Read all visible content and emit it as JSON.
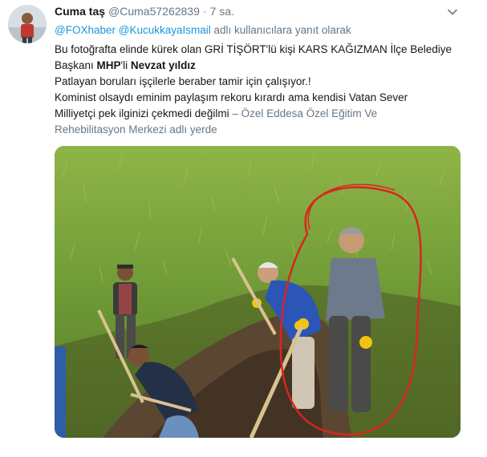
{
  "tweet": {
    "display_name": "Cuma taş",
    "handle": "@Cuma57262839",
    "separator": "·",
    "time": "7 sa.",
    "reply": {
      "mention_1": "@FOXhaber",
      "mention_2": "@KucukkayaIsmail",
      "suffix": "adlı kullanıcılara yanıt olarak"
    },
    "text": {
      "line1": "Bu fotoğrafta elinde kürek olan GRİ TİŞÖRT'lü kişi KARS KAĞIZMAN İlçe Belediye",
      "line2_pre": "Başkanı ",
      "line2_bold1": "MHP",
      "line2_mid": "'li ",
      "line2_bold2": "Nevzat yıldız",
      "line3": "Patlayan boruları işçilerle beraber tamir için çalışıyor.!",
      "line4": "Kominist olsaydı eminim paylaşım rekoru kırardı ama kendisi Vatan Sever",
      "line5_text": "Milliyetçi pek ilginizi çekmedi değilmi ",
      "line5_loc": " – Özel Eddesa Özel Eğitim Ve",
      "line6_loc": "Rehebilitasyon Merkezi adlı yerde"
    },
    "icons": {
      "menu": "chevron-down-icon"
    },
    "colors": {
      "link": "#1b95e0",
      "muted": "#657786",
      "text": "#14171a",
      "highlight_circle": "#d8261e"
    }
  }
}
